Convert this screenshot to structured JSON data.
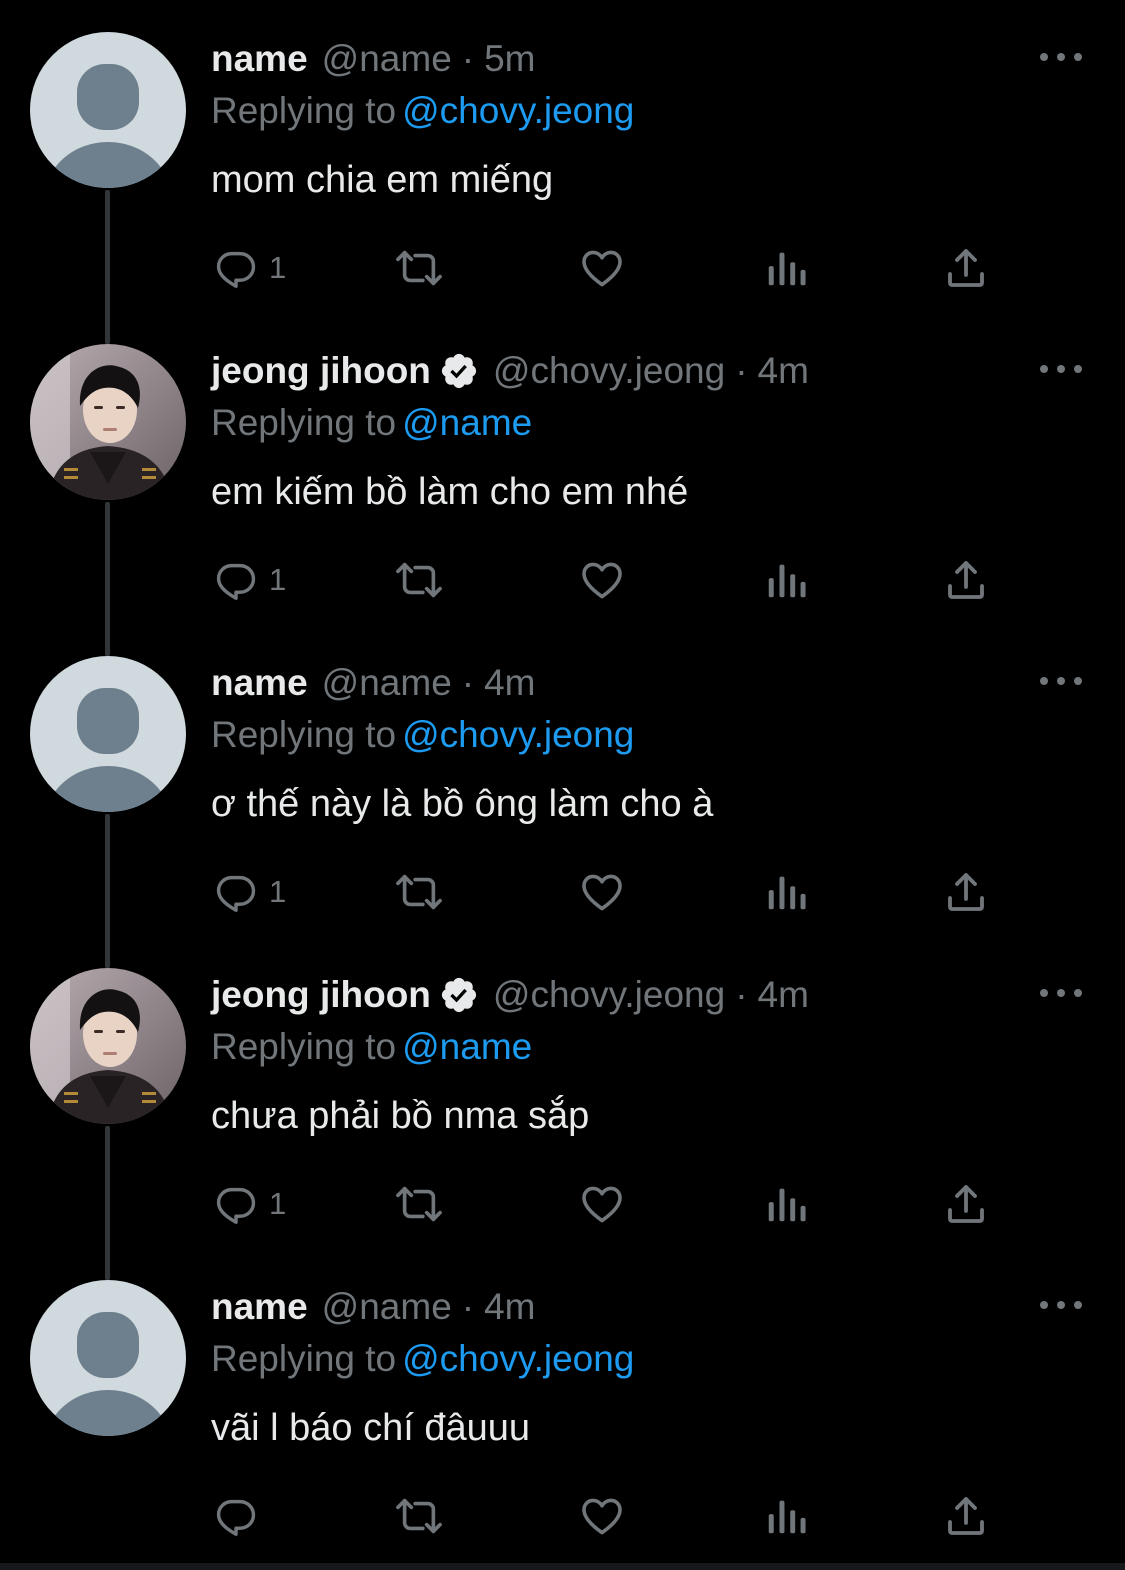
{
  "theme": {
    "background": "#000000",
    "text": "#e7e9ea",
    "muted": "#71767b",
    "accent": "#1d9bf0",
    "thread_line": "#333639"
  },
  "tweets": [
    {
      "author": "name",
      "handle": "@name",
      "separator": "·",
      "time": "5m",
      "verified": false,
      "avatar": "default-avatar",
      "replying_prefix": "Replying to",
      "replying_to": "@chovy.jeong",
      "text": "mom chia em miếng",
      "reply_count": "1"
    },
    {
      "author": "jeong jihoon",
      "handle": "@chovy.jeong",
      "separator": "·",
      "time": "4m",
      "verified": true,
      "avatar": "profile-photo",
      "replying_prefix": "Replying to",
      "replying_to": "@name",
      "text": "em kiếm bồ làm cho em nhé",
      "reply_count": "1"
    },
    {
      "author": "name",
      "handle": "@name",
      "separator": "·",
      "time": "4m",
      "verified": false,
      "avatar": "default-avatar",
      "replying_prefix": "Replying to",
      "replying_to": "@chovy.jeong",
      "text": "ơ thế này là bồ ông làm cho à",
      "reply_count": "1"
    },
    {
      "author": "jeong jihoon",
      "handle": "@chovy.jeong",
      "separator": "·",
      "time": "4m",
      "verified": true,
      "avatar": "profile-photo",
      "replying_prefix": "Replying to",
      "replying_to": "@name",
      "text": "chưa phải bồ nma sắp",
      "reply_count": "1"
    },
    {
      "author": "name",
      "handle": "@name",
      "separator": "·",
      "time": "4m",
      "verified": false,
      "avatar": "default-avatar",
      "replying_prefix": "Replying to",
      "replying_to": "@chovy.jeong",
      "text": "vãi l báo chí đâuuu",
      "reply_count": ""
    }
  ],
  "icons": {
    "more": "more-horizontal-icon",
    "reply": "reply-icon",
    "retweet": "retweet-icon",
    "like": "heart-icon",
    "views": "analytics-icon",
    "share": "share-icon",
    "verified": "verified-badge-icon"
  }
}
